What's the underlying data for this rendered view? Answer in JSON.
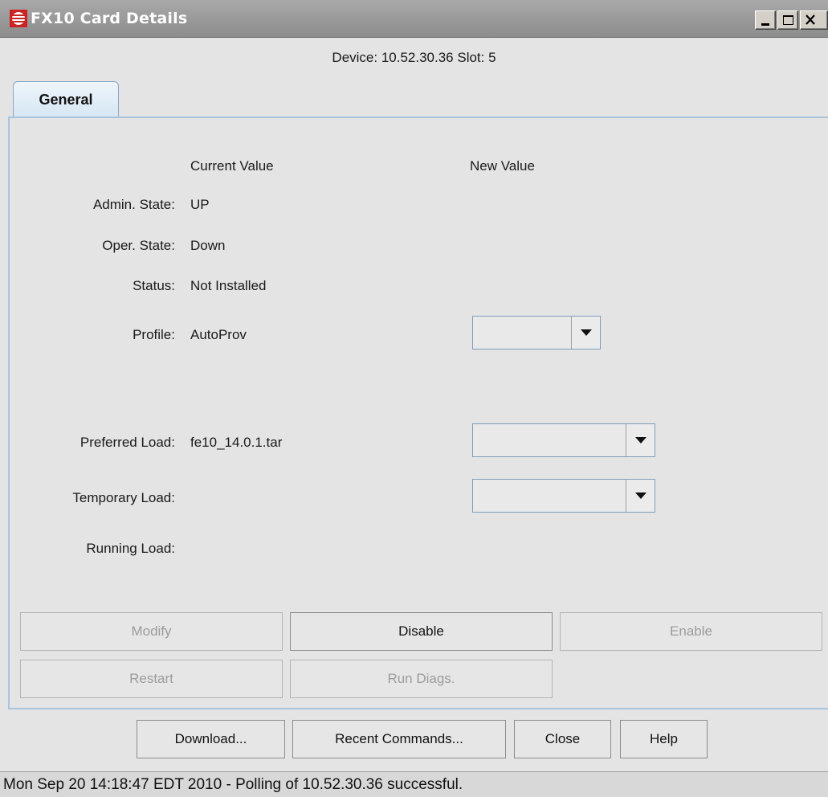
{
  "window": {
    "title": "FX10 Card Details",
    "minimize_icon": "minimize-icon",
    "maximize_icon": "maximize-icon",
    "close_icon": "close-icon"
  },
  "header": {
    "device_line": "Device: 10.52.30.36  Slot: 5"
  },
  "tabs": [
    {
      "label": "General",
      "selected": true
    }
  ],
  "columns": {
    "current": "Current Value",
    "new": "New Value"
  },
  "fields": {
    "admin_state": {
      "label": "Admin. State:",
      "current": "UP"
    },
    "oper_state": {
      "label": "Oper. State:",
      "current": "Down"
    },
    "status": {
      "label": "Status:",
      "current": "Not Installed"
    },
    "profile": {
      "label": "Profile:",
      "current": "AutoProv",
      "new_value": ""
    },
    "preferred_load": {
      "label": "Preferred Load:",
      "current": "fe10_14.0.1.tar",
      "new_value": ""
    },
    "temporary_load": {
      "label": "Temporary Load:",
      "current": "",
      "new_value": ""
    },
    "running_load": {
      "label": "Running Load:",
      "current": ""
    }
  },
  "actions": {
    "modify": {
      "label": "Modify",
      "enabled": false
    },
    "disable": {
      "label": "Disable",
      "enabled": true
    },
    "enable": {
      "label": "Enable",
      "enabled": false
    },
    "restart": {
      "label": "Restart",
      "enabled": false
    },
    "run_diags": {
      "label": "Run Diags.",
      "enabled": false
    }
  },
  "footer": {
    "download": "Download...",
    "recent_commands": "Recent Commands...",
    "close": "Close",
    "help": "Help"
  },
  "status": {
    "text": "Mon Sep 20 14:18:47 EDT 2010 - Polling of 10.52.30.36 successful."
  },
  "colors": {
    "accent": "#cc2222",
    "tab_border": "#8aa7c4",
    "titlebar": "#9a9a9a"
  }
}
